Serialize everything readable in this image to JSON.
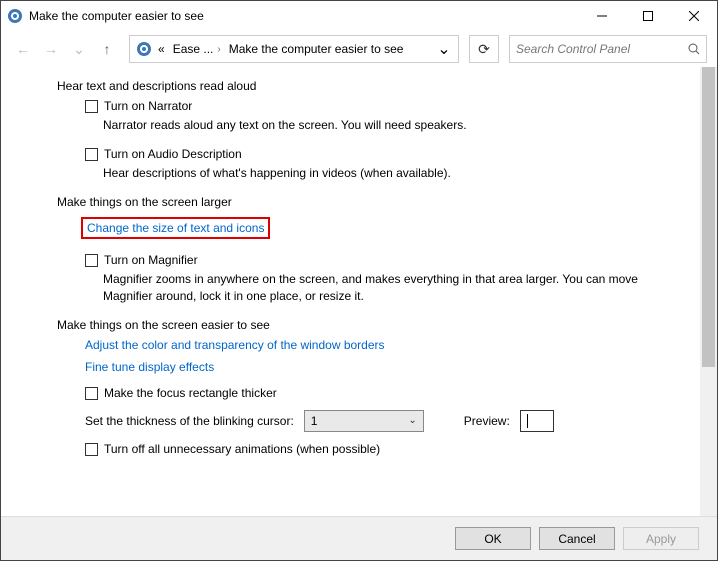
{
  "window": {
    "title": "Make the computer easier to see"
  },
  "breadcrumb": {
    "level1": "Ease ...",
    "level2": "Make the computer easier to see"
  },
  "search": {
    "placeholder": "Search Control Panel"
  },
  "sections": {
    "s1": {
      "head": "Hear text and descriptions read aloud",
      "narrator_cb": "Turn on Narrator",
      "narrator_desc": "Narrator reads aloud any text on the screen. You will need speakers.",
      "audio_cb": "Turn on Audio Description",
      "audio_desc": "Hear descriptions of what's happening in videos (when available)."
    },
    "s2": {
      "head": "Make things on the screen larger",
      "link": "Change the size of text and icons",
      "magnifier_cb": "Turn on Magnifier",
      "magnifier_desc": "Magnifier zooms in anywhere on the screen, and makes everything in that area larger. You can move Magnifier around, lock it in one place, or resize it."
    },
    "s3": {
      "head": "Make things on the screen easier to see",
      "link1": "Adjust the color and transparency of the window borders",
      "link2": "Fine tune display effects",
      "focus_cb": "Make the focus rectangle thicker",
      "thickness_label": "Set the thickness of the blinking cursor:",
      "thickness_value": "1",
      "preview_label": "Preview:",
      "anim_cb": "Turn off all unnecessary animations (when possible)"
    }
  },
  "footer": {
    "ok": "OK",
    "cancel": "Cancel",
    "apply": "Apply"
  }
}
